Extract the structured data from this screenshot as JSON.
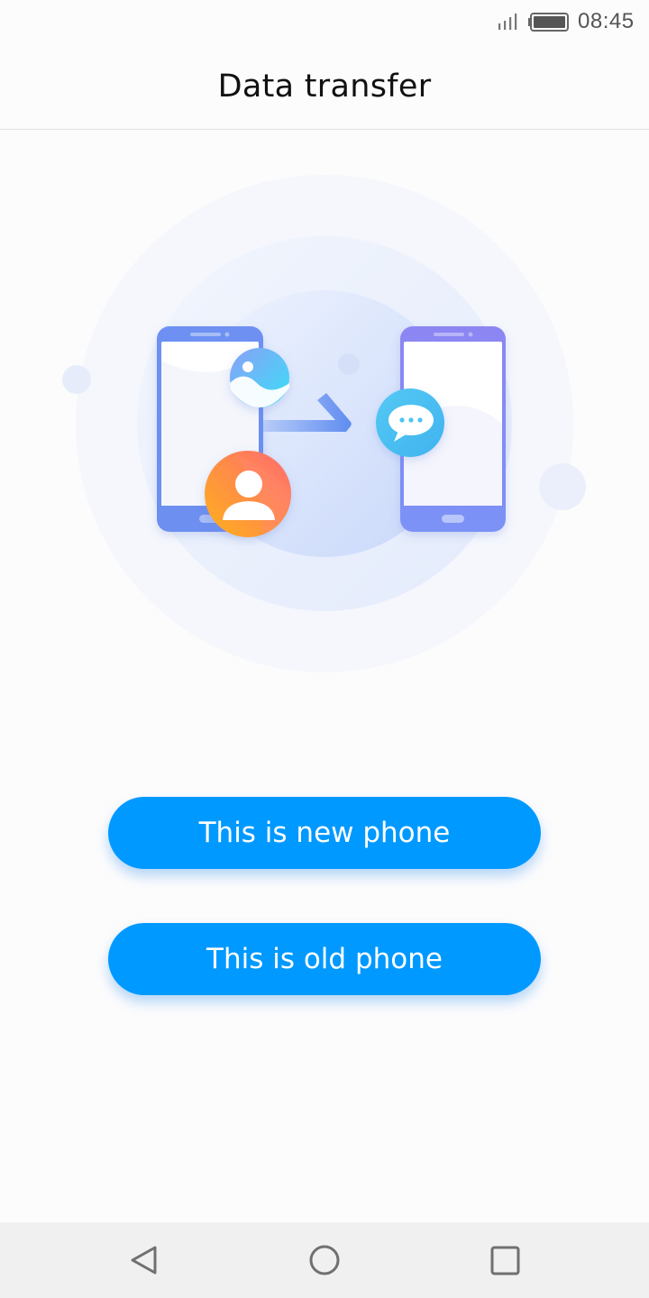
{
  "status_bar": {
    "time": "08:45",
    "signal_icon": "signal-icon",
    "battery_icon": "battery-icon"
  },
  "header": {
    "title": "Data transfer"
  },
  "illustration": {
    "description_icons": [
      "old-phone-icon",
      "new-phone-icon",
      "gallery-icon",
      "contact-icon",
      "message-icon",
      "transfer-arrow-icon"
    ]
  },
  "actions": {
    "new_phone_label": "This is new phone",
    "old_phone_label": "This is old phone"
  },
  "navigation": {
    "back_icon": "back-icon",
    "home_icon": "home-icon",
    "recent_icon": "recent-apps-icon"
  },
  "colors": {
    "accent": "#0099ff",
    "old_phone": "#6b8ff0",
    "new_phone": "#8a86f4",
    "contact_gradient_start": "#ffb020",
    "contact_gradient_end": "#ff6f6f",
    "message_bubble": "#4ec4f2"
  }
}
